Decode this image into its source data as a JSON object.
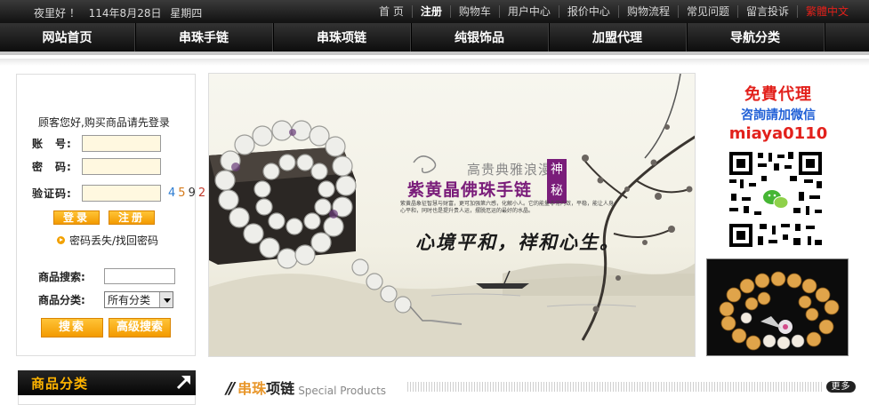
{
  "topbar": {
    "greeting": "夜里好 ！",
    "date": "114年8月28日",
    "weekday": "星期四",
    "links": [
      {
        "label": "首 页",
        "bold": false
      },
      {
        "label": "注册",
        "bold": true
      },
      {
        "label": "购物车",
        "bold": false
      },
      {
        "label": "用户中心",
        "bold": false
      },
      {
        "label": "报价中心",
        "bold": false
      },
      {
        "label": "购物流程",
        "bold": false
      },
      {
        "label": "常见问题",
        "bold": false
      },
      {
        "label": "留言投诉",
        "bold": false
      },
      {
        "label": "繁體中文",
        "bold": false
      }
    ]
  },
  "nav": {
    "items": [
      "网站首页",
      "串珠手链",
      "串珠项链",
      "纯银饰品",
      "加盟代理",
      "导航分类"
    ]
  },
  "login": {
    "hello": "顾客您好,购买商品请先登录",
    "account_label": "账　号:",
    "password_label": "密　码:",
    "captcha_label": "验证码:",
    "captcha_code": [
      "4",
      "5",
      "9",
      "2"
    ],
    "login_button": "登录",
    "register_button": "注册",
    "forgot_link": "密码丢失/找回密码",
    "search_label": "商品搜索:",
    "category_label": "商品分类:",
    "category_value": "所有分类",
    "search_button": "搜索",
    "advanced_search_button": "高级搜索"
  },
  "banner": {
    "subtitle": "高贵典雅浪漫",
    "seal": "神秘",
    "title": "紫黄晶佛珠手链",
    "description": "紫黄晶象征智慧与财富，更可加强第六感，化解小人。它的能量非常内敛，平稳，能让人身心平和，同时也是提升贵人运，摆脱厄运的最好的水晶。",
    "slogan": "心境平和，祥和心生。"
  },
  "promo": {
    "line1": "免費代理",
    "line2": "咨詢請加微信",
    "line3": "miaya0110"
  },
  "sidebar": {
    "category_title": "商品分类"
  },
  "section": {
    "title_part1": "串珠",
    "title_part2": "项链",
    "title_en": "Special Products",
    "more_label": "更多"
  }
}
